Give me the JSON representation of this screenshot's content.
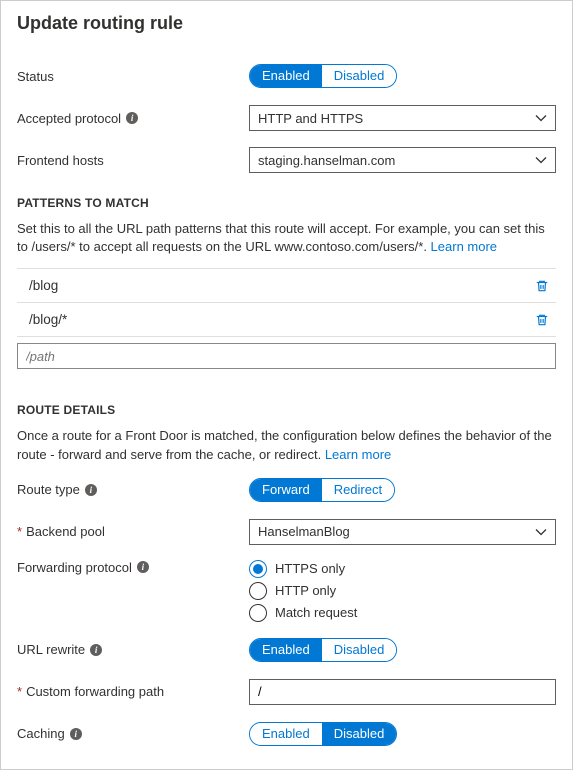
{
  "title": "Update routing rule",
  "status": {
    "label": "Status",
    "option_enabled": "Enabled",
    "option_disabled": "Disabled",
    "value": "Enabled"
  },
  "accepted_protocol": {
    "label": "Accepted protocol",
    "value": "HTTP and HTTPS"
  },
  "frontend_hosts": {
    "label": "Frontend hosts",
    "value": "staging.hanselman.com"
  },
  "patterns": {
    "heading": "PATTERNS TO MATCH",
    "description": "Set this to all the URL path patterns that this route will accept. For example, you can set this to /users/* to accept all requests on the URL www.contoso.com/users/*. ",
    "learn_more": "Learn more",
    "items": [
      {
        "path": "/blog"
      },
      {
        "path": "/blog/*"
      }
    ],
    "placeholder": "/path"
  },
  "route_details": {
    "heading": "ROUTE DETAILS",
    "description": "Once a route for a Front Door is matched, the configuration below defines the behavior of the route - forward and serve from the cache, or redirect. ",
    "learn_more": "Learn more"
  },
  "route_type": {
    "label": "Route type",
    "option_forward": "Forward",
    "option_redirect": "Redirect",
    "value": "Forward"
  },
  "backend_pool": {
    "label": "Backend pool",
    "value": "HanselmanBlog"
  },
  "forwarding_protocol": {
    "label": "Forwarding protocol",
    "options": [
      {
        "label": "HTTPS only",
        "selected": true
      },
      {
        "label": "HTTP only",
        "selected": false
      },
      {
        "label": "Match request",
        "selected": false
      }
    ]
  },
  "url_rewrite": {
    "label": "URL rewrite",
    "option_enabled": "Enabled",
    "option_disabled": "Disabled",
    "value": "Enabled"
  },
  "custom_forwarding_path": {
    "label": "Custom forwarding path",
    "value": "/"
  },
  "caching": {
    "label": "Caching",
    "option_enabled": "Enabled",
    "option_disabled": "Disabled",
    "value": "Disabled"
  }
}
